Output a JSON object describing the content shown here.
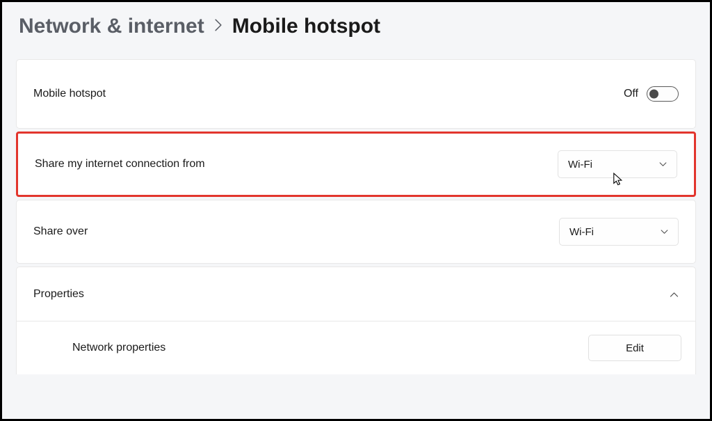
{
  "breadcrumb": {
    "parent": "Network & internet",
    "current": "Mobile hotspot"
  },
  "hotspot_toggle": {
    "label": "Mobile hotspot",
    "state_label": "Off"
  },
  "share_from": {
    "label": "Share my internet connection from",
    "value": "Wi-Fi"
  },
  "share_over": {
    "label": "Share over",
    "value": "Wi-Fi"
  },
  "properties": {
    "header": "Properties",
    "network_properties_label": "Network properties",
    "edit_button": "Edit"
  }
}
